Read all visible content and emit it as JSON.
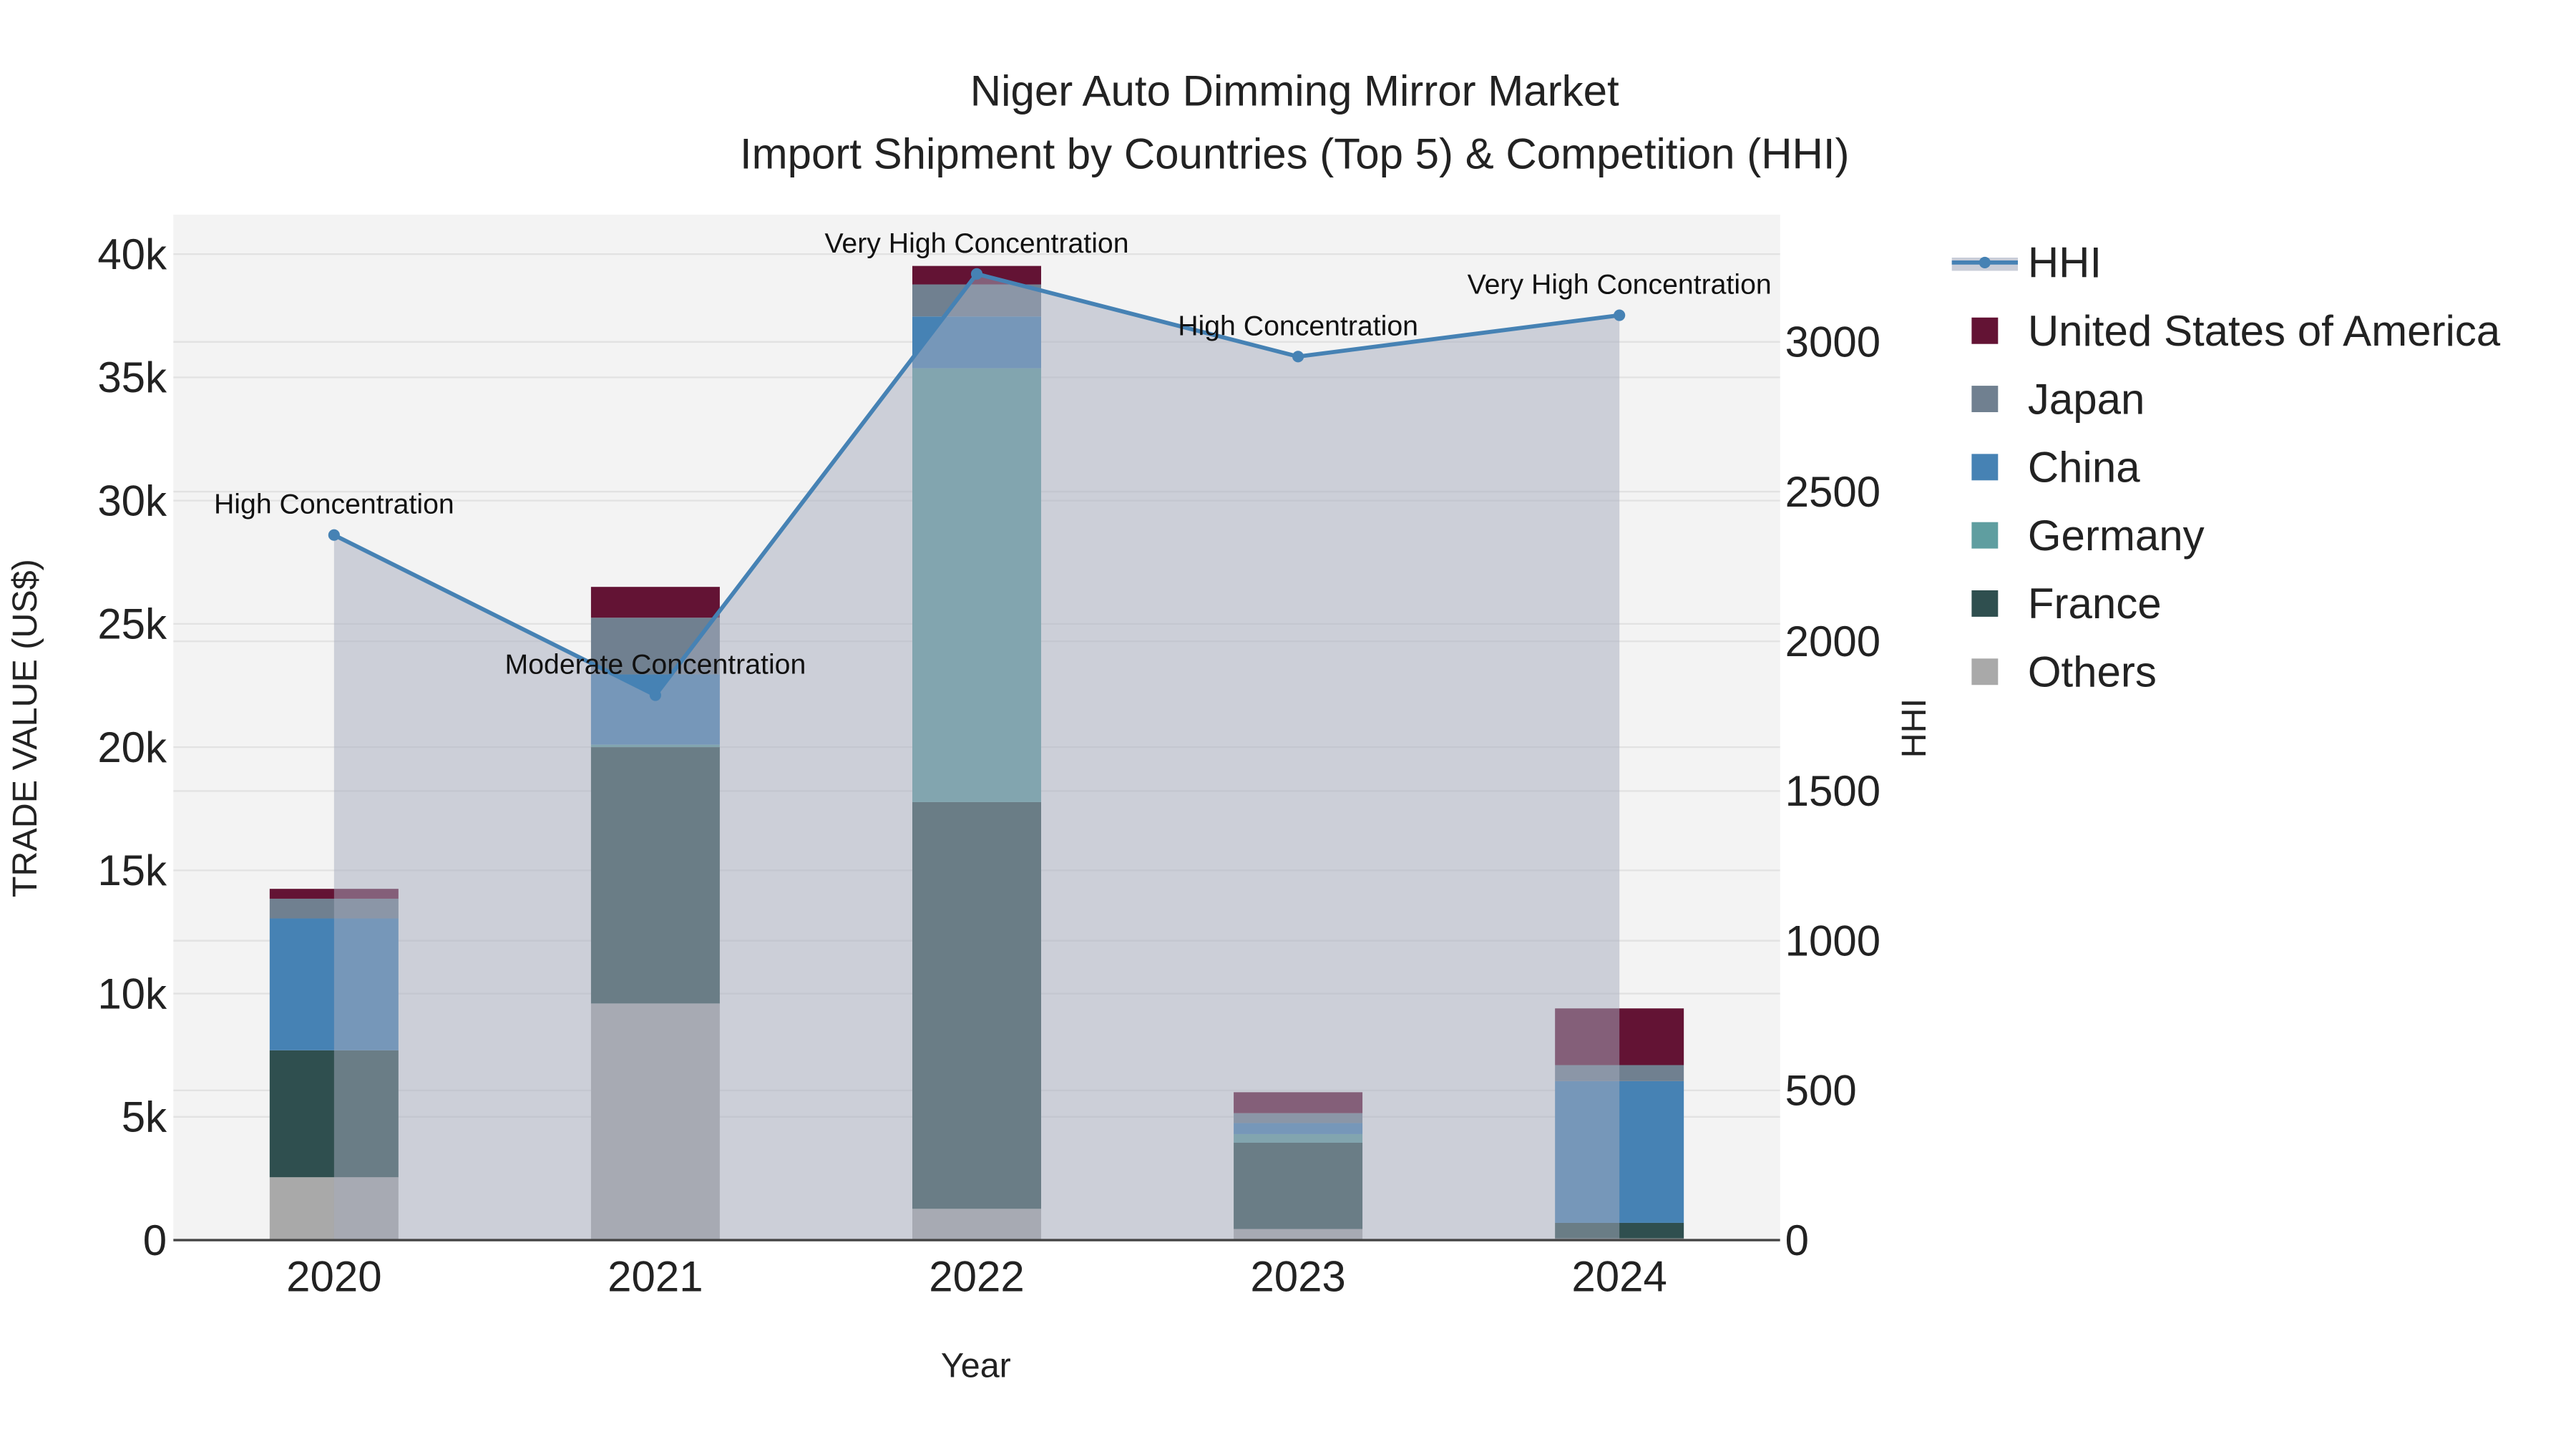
{
  "chart_data": {
    "type": "bar",
    "stacked": true,
    "title": "Niger Auto Dimming Mirror Market",
    "subtitle": "Import Shipment by Countries (Top 5) & Competition (HHI)",
    "xlabel": "Year",
    "ylabel": "TRADE VALUE (US$)",
    "y2label": "HHI",
    "categories": [
      "2020",
      "2021",
      "2022",
      "2023",
      "2024"
    ],
    "ylim": [
      0,
      41600
    ],
    "y_ticks": [
      0,
      5000,
      10000,
      15000,
      20000,
      25000,
      30000,
      35000,
      40000
    ],
    "y_tick_labels": [
      "0",
      "5k",
      "10k",
      "15k",
      "20k",
      "25k",
      "30k",
      "35k",
      "40k"
    ],
    "y2lim": [
      0,
      3425
    ],
    "y2_ticks": [
      0,
      500,
      1000,
      1500,
      2000,
      2500,
      3000
    ],
    "y2_tick_labels": [
      "0",
      "500",
      "1000",
      "1500",
      "2000",
      "2500",
      "3000"
    ],
    "grid": true,
    "legend_position": "right",
    "series": [
      {
        "name": "Others",
        "color": "#a9a9a9",
        "values": [
          2550,
          9600,
          1270,
          450,
          70
        ]
      },
      {
        "name": "France",
        "color": "#2f4f4f",
        "values": [
          5150,
          10400,
          16500,
          3500,
          630
        ]
      },
      {
        "name": "Germany",
        "color": "#5f9ea0",
        "values": [
          0,
          100,
          17600,
          350,
          0
        ]
      },
      {
        "name": "China",
        "color": "#4682b4",
        "values": [
          5350,
          2850,
          2100,
          450,
          5750
        ]
      },
      {
        "name": "Japan",
        "color": "#708090",
        "values": [
          800,
          2300,
          1300,
          400,
          650
        ]
      },
      {
        "name": "United States of America",
        "color": "#631334",
        "values": [
          400,
          1250,
          750,
          850,
          2300
        ]
      }
    ],
    "hhi": {
      "name": "HHI",
      "color": "#4682b4",
      "values": [
        2355,
        1820,
        3227,
        2951,
        3089
      ],
      "annotations": [
        "High Concentration",
        "Moderate Concentration",
        "Very High Concentration",
        "High Concentration",
        "Very High Concentration"
      ]
    },
    "legend_order": [
      "HHI",
      "United States of America",
      "Japan",
      "China",
      "Germany",
      "France",
      "Others"
    ]
  }
}
